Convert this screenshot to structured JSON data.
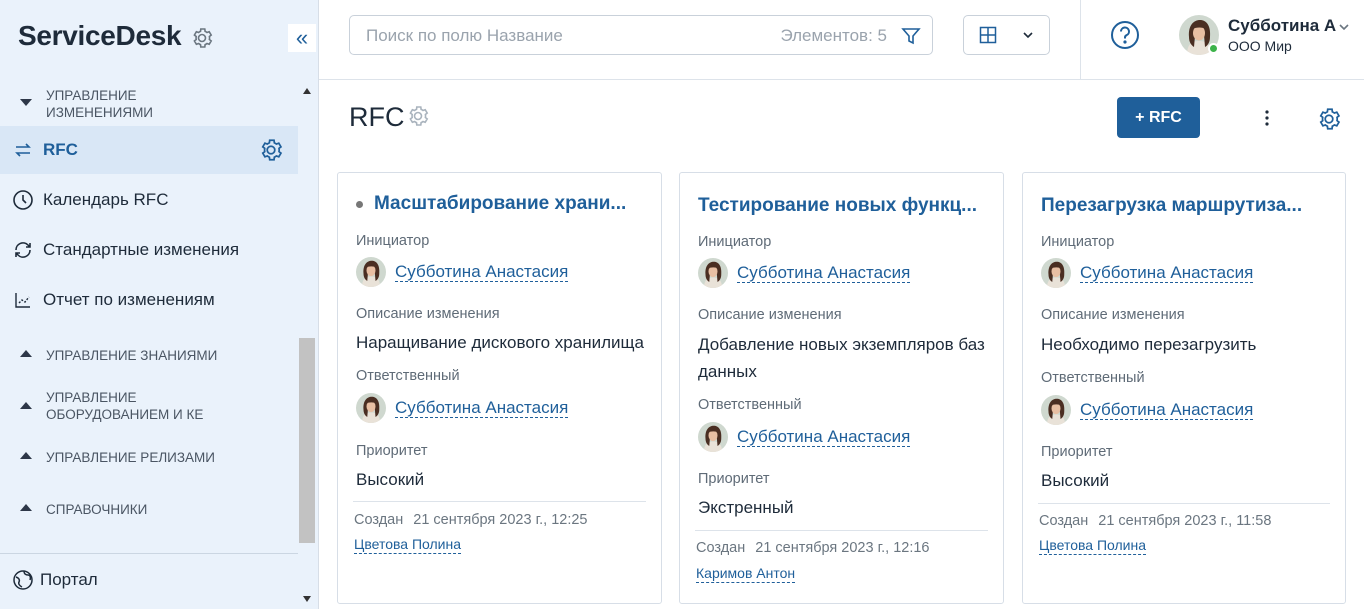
{
  "app": {
    "brand": "ServiceDesk"
  },
  "sidebar": {
    "groups": {
      "changes": "УПРАВЛЕНИЕ ИЗМЕНЕНИЯМИ",
      "knowledge": "УПРАВЛЕНИЕ ЗНАНИЯМИ",
      "equipment": "УПРАВЛЕНИЕ ОБОРУДОВАНИЕМ И КЕ",
      "releases": "УПРАВЛЕНИЕ РЕЛИЗАМИ",
      "refs": "СПРАВОЧНИКИ"
    },
    "items": [
      {
        "label": "RFC",
        "icon": "swap-arrows-icon",
        "active": true
      },
      {
        "label": "Календарь RFC",
        "icon": "clock-icon"
      },
      {
        "label": "Стандартные изменения",
        "icon": "refresh-icon"
      },
      {
        "label": "Отчет по изменениям",
        "icon": "chart-icon"
      }
    ],
    "portal": "Портал"
  },
  "topbar": {
    "search_placeholder": "Поиск по полю Название",
    "count": "Элементов: 5",
    "user_name": "Субботина А",
    "user_org": "ООО Мир"
  },
  "main": {
    "title": "RFC",
    "add_button": "+ RFC"
  },
  "labels": {
    "initiator": "Инициатор",
    "description": "Описание изменения",
    "responsible": "Ответственный",
    "priority": "Приоритет",
    "created": "Создан"
  },
  "cards": [
    {
      "title": "Масштабирование храни...",
      "initiator": "Субботина Анастасия",
      "description": "Наращивание дискового хранилища",
      "responsible": "Субботина Анастасия",
      "priority": "Высокий",
      "created_at": "21 сентября 2023 г., 12:25",
      "author": "Цветова Полина"
    },
    {
      "title": "Тестирование новых функц...",
      "initiator": "Субботина Анастасия",
      "description": "Добавление новых экземпляров баз данных",
      "responsible": "Субботина Анастасия",
      "priority": "Экстренный",
      "created_at": "21 сентября 2023 г., 12:16",
      "author": "Каримов Антон"
    },
    {
      "title": "Перезагрузка маршрутиза...",
      "initiator": "Субботина Анастасия",
      "description": "Необходимо перезагрузить",
      "responsible": "Субботина Анастасия",
      "priority": "Высокий",
      "created_at": "21 сентября 2023 г., 11:58",
      "author": "Цветова Полина"
    }
  ],
  "colors": {
    "accent": "#1f5f9a",
    "sidebar_bg": "#eaf2fb",
    "online": "#3cb34a"
  }
}
